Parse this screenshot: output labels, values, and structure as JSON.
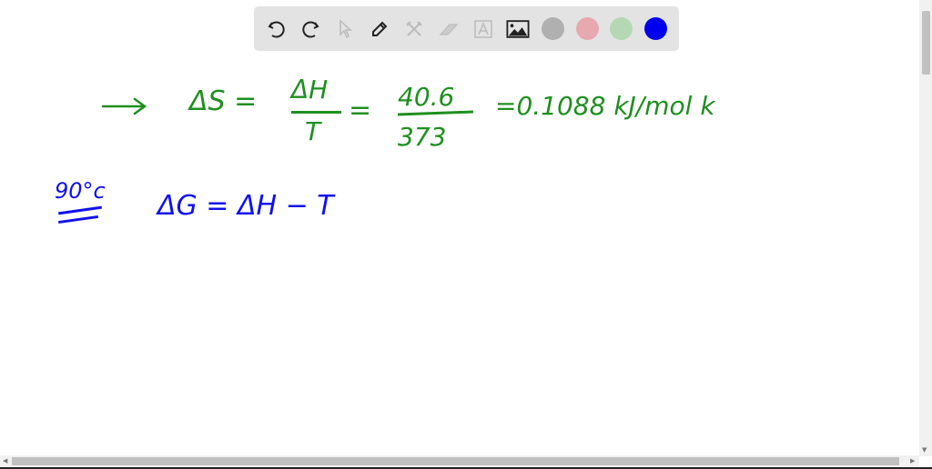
{
  "toolbar": {
    "tools": [
      "undo-icon",
      "redo-icon",
      "select-icon",
      "pen-icon",
      "tools-icon",
      "eraser-icon",
      "text-icon",
      "image-icon"
    ],
    "colors": [
      "#b0b0b0",
      "#e8a8b0",
      "#b4d8b4",
      "#0000ee"
    ]
  },
  "canvas": {
    "line1": {
      "lhs": "ΔS =",
      "frac1_num": "ΔH",
      "frac1_den": "T",
      "eq1": "=",
      "frac2_num": "40.6",
      "frac2_den": "373",
      "result": "=0.1088 kJ/mol k",
      "color": "#1f8f1f"
    },
    "line2": {
      "label": "90°c",
      "equation": "ΔG = ΔH − T",
      "color": "#1010ee"
    }
  }
}
